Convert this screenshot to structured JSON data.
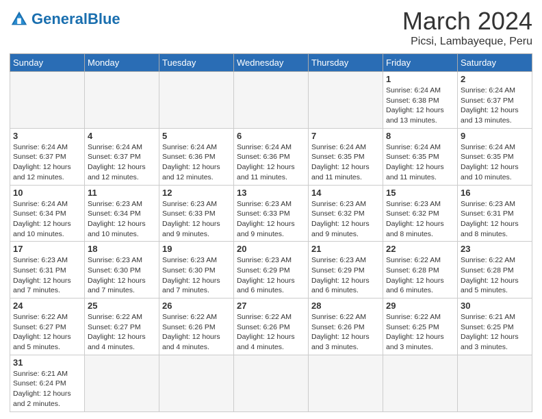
{
  "header": {
    "logo_general": "General",
    "logo_blue": "Blue",
    "month_title": "March 2024",
    "location": "Picsi, Lambayeque, Peru"
  },
  "days_of_week": [
    "Sunday",
    "Monday",
    "Tuesday",
    "Wednesday",
    "Thursday",
    "Friday",
    "Saturday"
  ],
  "weeks": [
    [
      {
        "day": "",
        "info": "",
        "empty": true
      },
      {
        "day": "",
        "info": "",
        "empty": true
      },
      {
        "day": "",
        "info": "",
        "empty": true
      },
      {
        "day": "",
        "info": "",
        "empty": true
      },
      {
        "day": "",
        "info": "",
        "empty": true
      },
      {
        "day": "1",
        "info": "Sunrise: 6:24 AM\nSunset: 6:38 PM\nDaylight: 12 hours and 13 minutes."
      },
      {
        "day": "2",
        "info": "Sunrise: 6:24 AM\nSunset: 6:37 PM\nDaylight: 12 hours and 13 minutes."
      }
    ],
    [
      {
        "day": "3",
        "info": "Sunrise: 6:24 AM\nSunset: 6:37 PM\nDaylight: 12 hours and 12 minutes."
      },
      {
        "day": "4",
        "info": "Sunrise: 6:24 AM\nSunset: 6:37 PM\nDaylight: 12 hours and 12 minutes."
      },
      {
        "day": "5",
        "info": "Sunrise: 6:24 AM\nSunset: 6:36 PM\nDaylight: 12 hours and 12 minutes."
      },
      {
        "day": "6",
        "info": "Sunrise: 6:24 AM\nSunset: 6:36 PM\nDaylight: 12 hours and 11 minutes."
      },
      {
        "day": "7",
        "info": "Sunrise: 6:24 AM\nSunset: 6:35 PM\nDaylight: 12 hours and 11 minutes."
      },
      {
        "day": "8",
        "info": "Sunrise: 6:24 AM\nSunset: 6:35 PM\nDaylight: 12 hours and 11 minutes."
      },
      {
        "day": "9",
        "info": "Sunrise: 6:24 AM\nSunset: 6:35 PM\nDaylight: 12 hours and 10 minutes."
      }
    ],
    [
      {
        "day": "10",
        "info": "Sunrise: 6:24 AM\nSunset: 6:34 PM\nDaylight: 12 hours and 10 minutes."
      },
      {
        "day": "11",
        "info": "Sunrise: 6:23 AM\nSunset: 6:34 PM\nDaylight: 12 hours and 10 minutes."
      },
      {
        "day": "12",
        "info": "Sunrise: 6:23 AM\nSunset: 6:33 PM\nDaylight: 12 hours and 9 minutes."
      },
      {
        "day": "13",
        "info": "Sunrise: 6:23 AM\nSunset: 6:33 PM\nDaylight: 12 hours and 9 minutes."
      },
      {
        "day": "14",
        "info": "Sunrise: 6:23 AM\nSunset: 6:32 PM\nDaylight: 12 hours and 9 minutes."
      },
      {
        "day": "15",
        "info": "Sunrise: 6:23 AM\nSunset: 6:32 PM\nDaylight: 12 hours and 8 minutes."
      },
      {
        "day": "16",
        "info": "Sunrise: 6:23 AM\nSunset: 6:31 PM\nDaylight: 12 hours and 8 minutes."
      }
    ],
    [
      {
        "day": "17",
        "info": "Sunrise: 6:23 AM\nSunset: 6:31 PM\nDaylight: 12 hours and 7 minutes."
      },
      {
        "day": "18",
        "info": "Sunrise: 6:23 AM\nSunset: 6:30 PM\nDaylight: 12 hours and 7 minutes."
      },
      {
        "day": "19",
        "info": "Sunrise: 6:23 AM\nSunset: 6:30 PM\nDaylight: 12 hours and 7 minutes."
      },
      {
        "day": "20",
        "info": "Sunrise: 6:23 AM\nSunset: 6:29 PM\nDaylight: 12 hours and 6 minutes."
      },
      {
        "day": "21",
        "info": "Sunrise: 6:23 AM\nSunset: 6:29 PM\nDaylight: 12 hours and 6 minutes."
      },
      {
        "day": "22",
        "info": "Sunrise: 6:22 AM\nSunset: 6:28 PM\nDaylight: 12 hours and 6 minutes."
      },
      {
        "day": "23",
        "info": "Sunrise: 6:22 AM\nSunset: 6:28 PM\nDaylight: 12 hours and 5 minutes."
      }
    ],
    [
      {
        "day": "24",
        "info": "Sunrise: 6:22 AM\nSunset: 6:27 PM\nDaylight: 12 hours and 5 minutes."
      },
      {
        "day": "25",
        "info": "Sunrise: 6:22 AM\nSunset: 6:27 PM\nDaylight: 12 hours and 4 minutes."
      },
      {
        "day": "26",
        "info": "Sunrise: 6:22 AM\nSunset: 6:26 PM\nDaylight: 12 hours and 4 minutes."
      },
      {
        "day": "27",
        "info": "Sunrise: 6:22 AM\nSunset: 6:26 PM\nDaylight: 12 hours and 4 minutes."
      },
      {
        "day": "28",
        "info": "Sunrise: 6:22 AM\nSunset: 6:26 PM\nDaylight: 12 hours and 3 minutes."
      },
      {
        "day": "29",
        "info": "Sunrise: 6:22 AM\nSunset: 6:25 PM\nDaylight: 12 hours and 3 minutes."
      },
      {
        "day": "30",
        "info": "Sunrise: 6:21 AM\nSunset: 6:25 PM\nDaylight: 12 hours and 3 minutes."
      }
    ],
    [
      {
        "day": "31",
        "info": "Sunrise: 6:21 AM\nSunset: 6:24 PM\nDaylight: 12 hours and 2 minutes."
      },
      {
        "day": "",
        "info": "",
        "empty": true
      },
      {
        "day": "",
        "info": "",
        "empty": true
      },
      {
        "day": "",
        "info": "",
        "empty": true
      },
      {
        "day": "",
        "info": "",
        "empty": true
      },
      {
        "day": "",
        "info": "",
        "empty": true
      },
      {
        "day": "",
        "info": "",
        "empty": true
      }
    ]
  ]
}
